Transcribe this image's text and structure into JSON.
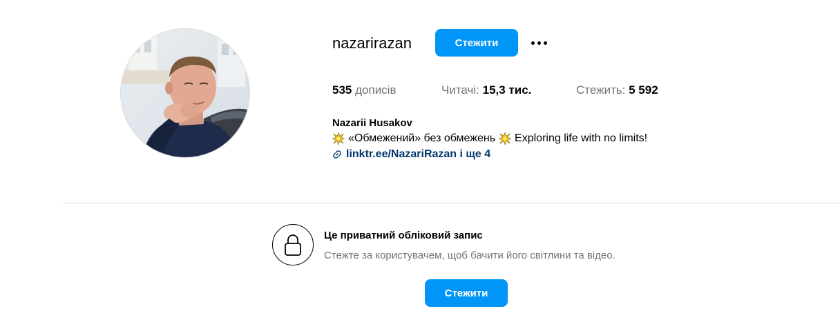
{
  "profile": {
    "username": "nazarirazan",
    "follow_label": "Стежити",
    "more_label": "More options",
    "stats": {
      "posts_count": "535",
      "posts_label": "дописів",
      "followers_label": "Читачі:",
      "followers_count": "15,3 тис.",
      "following_label": "Стежить:",
      "following_count": "5 592"
    },
    "full_name": "Nazarii Husakov",
    "bio": {
      "emoji_icon": "sparkle-burst-icon",
      "text": "«Обмежений» без обмежень",
      "text_en": "Exploring life with no limits!"
    },
    "link": {
      "icon": "link-icon",
      "text": "linktr.ee/NazariRazan і ще 4"
    }
  },
  "private": {
    "icon": "lock-icon",
    "title": "Це приватний обліковий запис",
    "subtitle": "Стежте за користувачем, щоб бачити його світлини та відео.",
    "follow_label": "Стежити"
  },
  "colors": {
    "accent": "#0095f6",
    "link": "#00376b",
    "secondary_text": "#737373",
    "divider": "#dbdbdb"
  }
}
